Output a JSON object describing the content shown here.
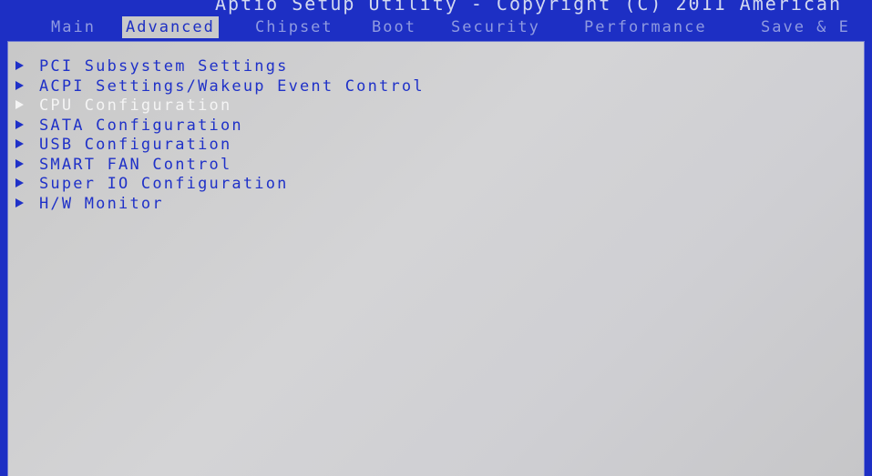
{
  "header": {
    "title": "Aptio Setup Utility - Copyright (C) 2011 American"
  },
  "tabs": [
    {
      "label": "Main"
    },
    {
      "label": "Advanced"
    },
    {
      "label": "Chipset"
    },
    {
      "label": "Boot"
    },
    {
      "label": "Security"
    },
    {
      "label": "Performance"
    },
    {
      "label": "Save & E"
    }
  ],
  "active_tab": "Advanced",
  "menu": {
    "items": [
      {
        "label": "PCI Subsystem Settings",
        "icon": "arrow-right-icon"
      },
      {
        "label": "ACPI Settings/Wakeup Event Control",
        "icon": "arrow-right-icon"
      },
      {
        "label": "CPU Configuration",
        "icon": "arrow-right-icon"
      },
      {
        "label": "SATA Configuration",
        "icon": "arrow-right-icon"
      },
      {
        "label": "USB Configuration",
        "icon": "arrow-right-icon"
      },
      {
        "label": "SMART FAN Control",
        "icon": "arrow-right-icon"
      },
      {
        "label": "Super IO Configuration",
        "icon": "arrow-right-icon"
      },
      {
        "label": "H/W Monitor",
        "icon": "arrow-right-icon"
      }
    ],
    "selected": "CPU Configuration"
  },
  "colors": {
    "background": "#1d2fc4",
    "panel": "#c9c9c9",
    "text": "#1f31c8",
    "highlight": "#f4f4f4"
  }
}
